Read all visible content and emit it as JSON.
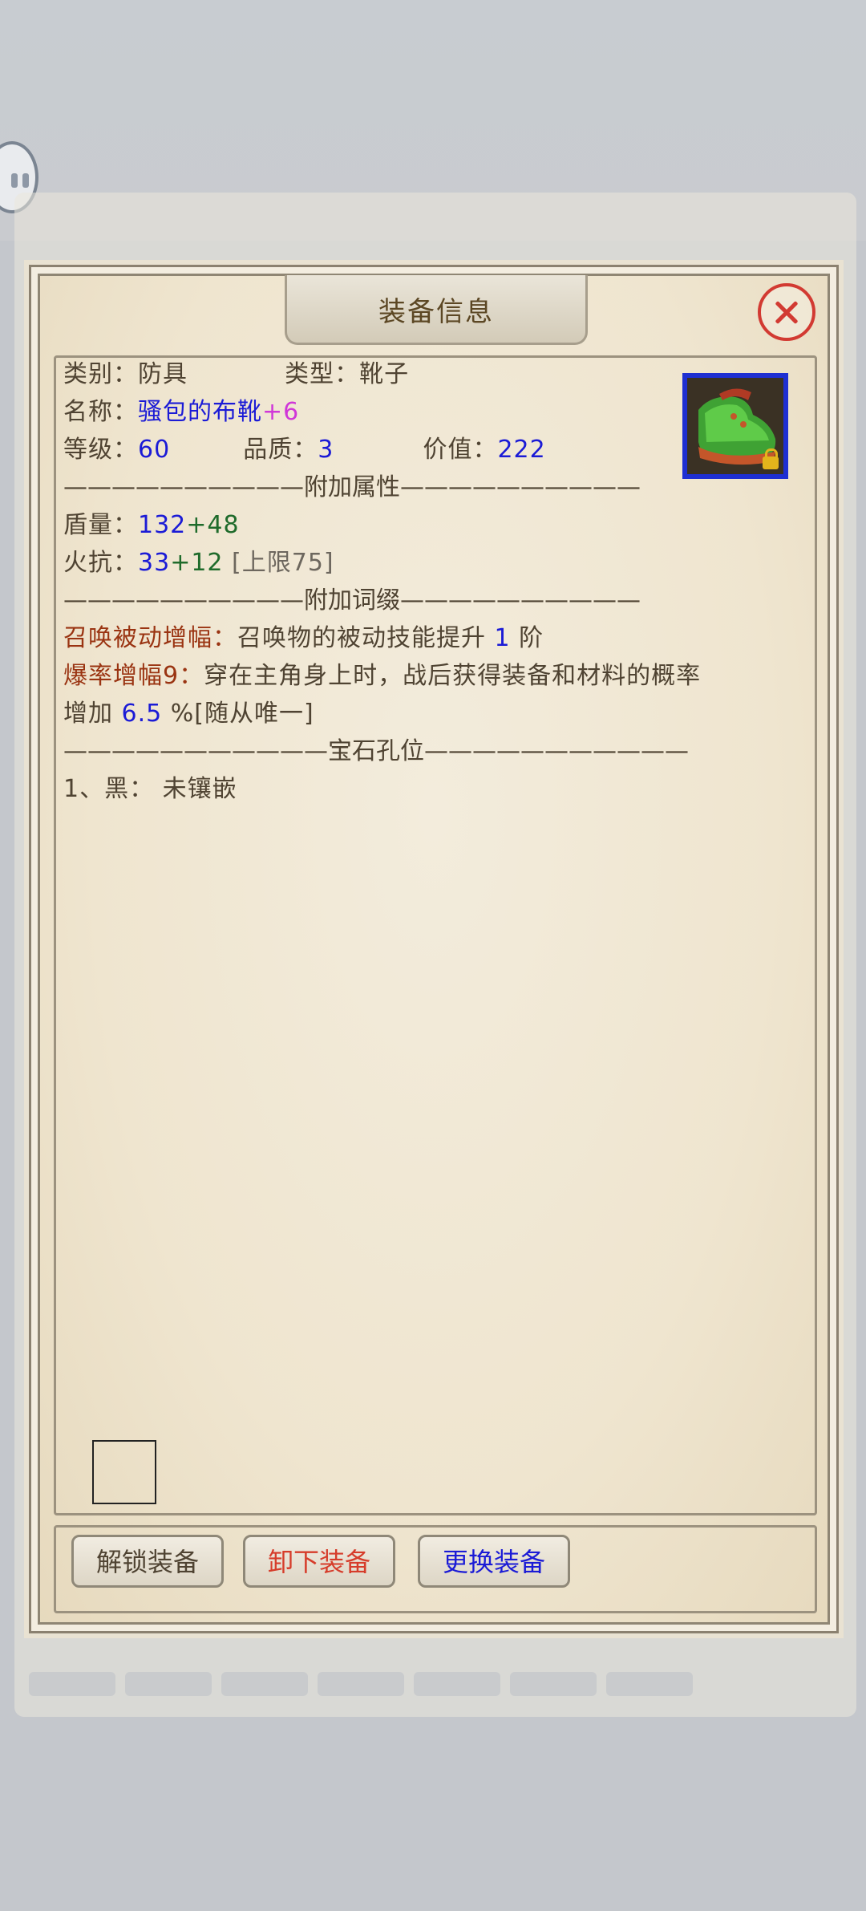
{
  "dialog": {
    "title": "装备信息"
  },
  "item": {
    "icon": "green-cloth-boots-icon",
    "locked": true,
    "category_label": "类别：",
    "category_value": "防具",
    "type_label": "类型：",
    "type_value": "靴子",
    "name_label": "名称：",
    "name_value": "骚包的布靴",
    "name_plus": "+6",
    "level_label": "等级：",
    "level_value": "60",
    "quality_label": "品质：",
    "quality_value": "3",
    "price_label": "价值：",
    "price_value": "222"
  },
  "sections": {
    "attr_divider": "——————————附加属性——————————",
    "affix_divider": "——————————附加词缀——————————",
    "gem_divider": "———————————宝石孔位———————————"
  },
  "attributes": [
    {
      "label": "盾量：",
      "base": "132",
      "bonus": "+48",
      "cap": ""
    },
    {
      "label": "火抗：",
      "base": "33",
      "bonus": "+12",
      "cap": "[上限75]"
    }
  ],
  "affixes": [
    {
      "name": "召唤被动增幅：",
      "text": "召唤物的被动技能提升 ",
      "value": "1",
      "suffix": " 阶"
    },
    {
      "name": "爆率增幅9：",
      "text": "穿在主角身上时，战后获得装备和材料的概率",
      "text2": "增加 ",
      "value": "6.5",
      "suffix": " %[随从唯一]"
    }
  ],
  "gems": [
    {
      "text": "1、黑：  未镶嵌"
    }
  ],
  "buttons": {
    "unlock": "解锁装备",
    "unequip": "卸下装备",
    "replace": "更换装备"
  },
  "colors": {
    "value_blue": "#1b1bd6",
    "bonus_green": "#1f6b2b",
    "plus_magenta": "#d037d8",
    "affix_name": "#9a3412",
    "close_red": "#d23a32"
  }
}
